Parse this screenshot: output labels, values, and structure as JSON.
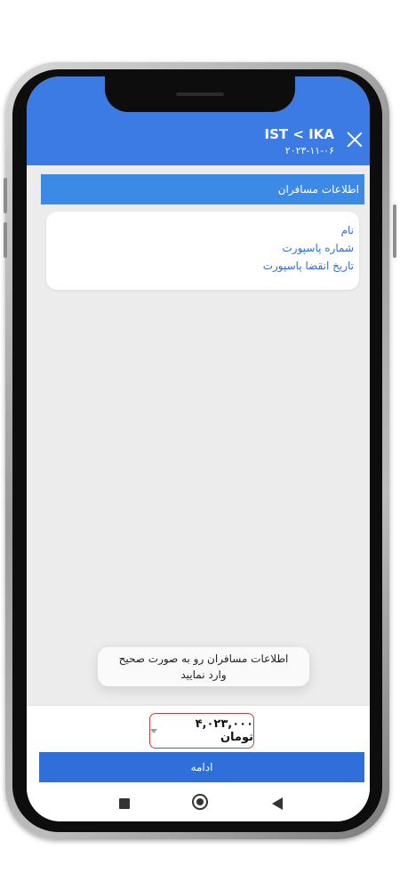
{
  "header": {
    "route": "IST < IKA",
    "date": "۲۰۲۳-۱۱-۰۶"
  },
  "section": {
    "title": "اطلاعات مسافران"
  },
  "passenger_card": {
    "fields": [
      "نام",
      "شماره پاسپورت",
      "تاریخ انقضا پاسپورت"
    ]
  },
  "toast": {
    "line1": "اطلاعات مسافران رو به صورت صحیح",
    "line2": "وارد نمایید"
  },
  "footer": {
    "price": "۴,۰۲۳,۰۰۰ تومان",
    "continue_label": "ادامه"
  },
  "colors": {
    "header": "#3b7be3",
    "section_bar": "#3b8ae6",
    "button": "#2e6fd9",
    "price_border": "#d53a3a",
    "field_text": "#2f6fd6"
  },
  "icons": [
    "close-icon",
    "caret-down-icon",
    "recent-apps-icon",
    "home-icon",
    "back-icon"
  ]
}
